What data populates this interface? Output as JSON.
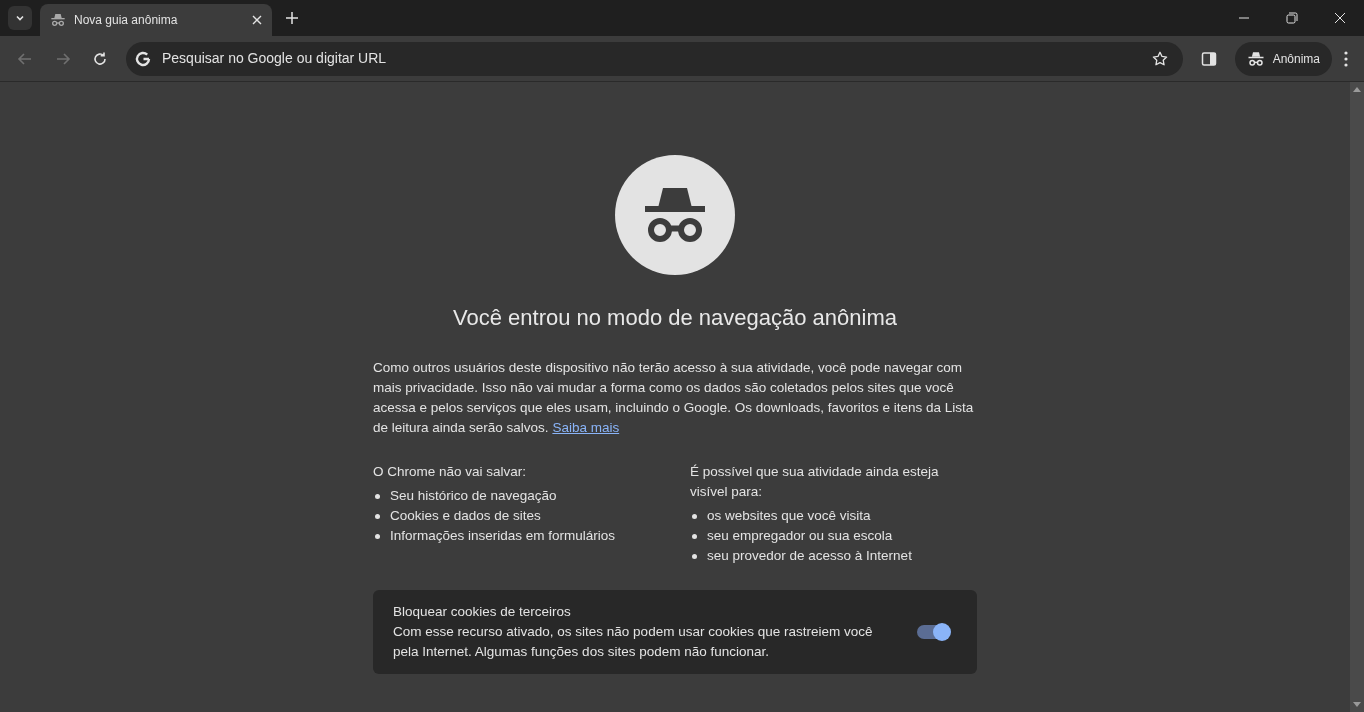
{
  "tabs": [
    {
      "title": "Nova guia anônima",
      "selected": true
    }
  ],
  "toolbar": {
    "back_disabled": true,
    "forward_disabled": true,
    "omnibox": {
      "placeholder": "Pesquisar no Google ou digitar URL",
      "starred": false
    },
    "profile_label": "Anônima"
  },
  "page": {
    "heading": "Você entrou no modo de navegação anônima",
    "intro": "Como outros usuários deste dispositivo não terão acesso à sua atividade, você pode navegar com mais privacidade. Isso não vai mudar a forma como os dados são coletados pelos sites que você acessa e pelos serviços que eles usam, incluindo o Google. Os downloads, favoritos e itens da Lista de leitura ainda serão salvos.",
    "learn_more": "Saiba mais",
    "columns": [
      {
        "heading": "O Chrome não vai salvar:",
        "items": [
          "Seu histórico de navegação",
          "Cookies e dados de sites",
          "Informações inseridas em formulários"
        ]
      },
      {
        "heading": "É possível que sua atividade ainda esteja visível para:",
        "items": [
          "os websites que você visita",
          "seu empregador ou sua escola",
          "seu provedor de acesso à Internet"
        ]
      }
    ],
    "cookie_card": {
      "title": "Bloquear cookies de terceiros",
      "description": "Com esse recurso ativado, os sites não podem usar cookies que rastreiem você pela Internet. Algumas funções dos sites podem não funcionar.",
      "on": true
    }
  }
}
